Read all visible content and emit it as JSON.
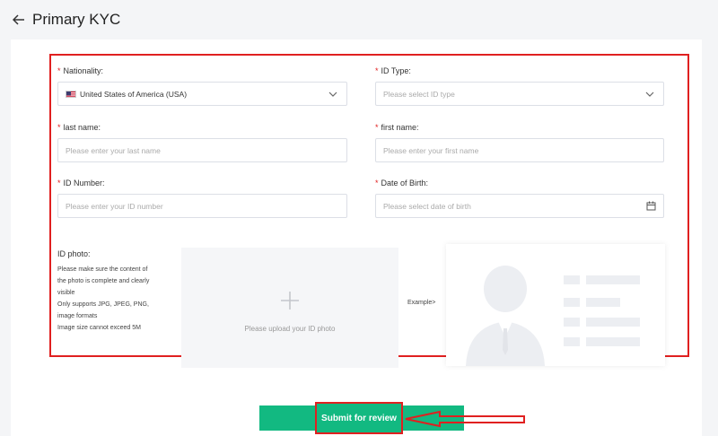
{
  "header": {
    "title": "Primary KYC"
  },
  "form": {
    "nationality": {
      "label": "Nationality:",
      "value": "United States of America (USA)"
    },
    "id_type": {
      "label": "ID Type:",
      "placeholder": "Please select ID type"
    },
    "last_name": {
      "label": "last name:",
      "placeholder": "Please enter your last name"
    },
    "first_name": {
      "label": "first name:",
      "placeholder": "Please enter your first name"
    },
    "id_number": {
      "label": "ID Number:",
      "placeholder": "Please enter your ID number"
    },
    "dob": {
      "label": "Date of Birth:",
      "placeholder": "Please select date of birth"
    },
    "required_mark": "*"
  },
  "photo": {
    "title": "ID photo:",
    "notes": [
      "Please make sure the content of",
      "the photo is complete and clearly",
      "visible",
      "Only supports JPG, JPEG, PNG,",
      "image formats",
      "Image size cannot exceed 5M"
    ],
    "upload_text": "Please upload your ID photo",
    "example_label": "Example>"
  },
  "submit": {
    "label": "Submit for review"
  },
  "colors": {
    "accent": "#12b981",
    "highlight": "#e02020"
  },
  "icons": {
    "back": "arrow-left-icon",
    "chevron": "chevron-down-icon",
    "calendar": "calendar-icon",
    "upload": "plus-icon",
    "flag": "us-flag-icon"
  }
}
